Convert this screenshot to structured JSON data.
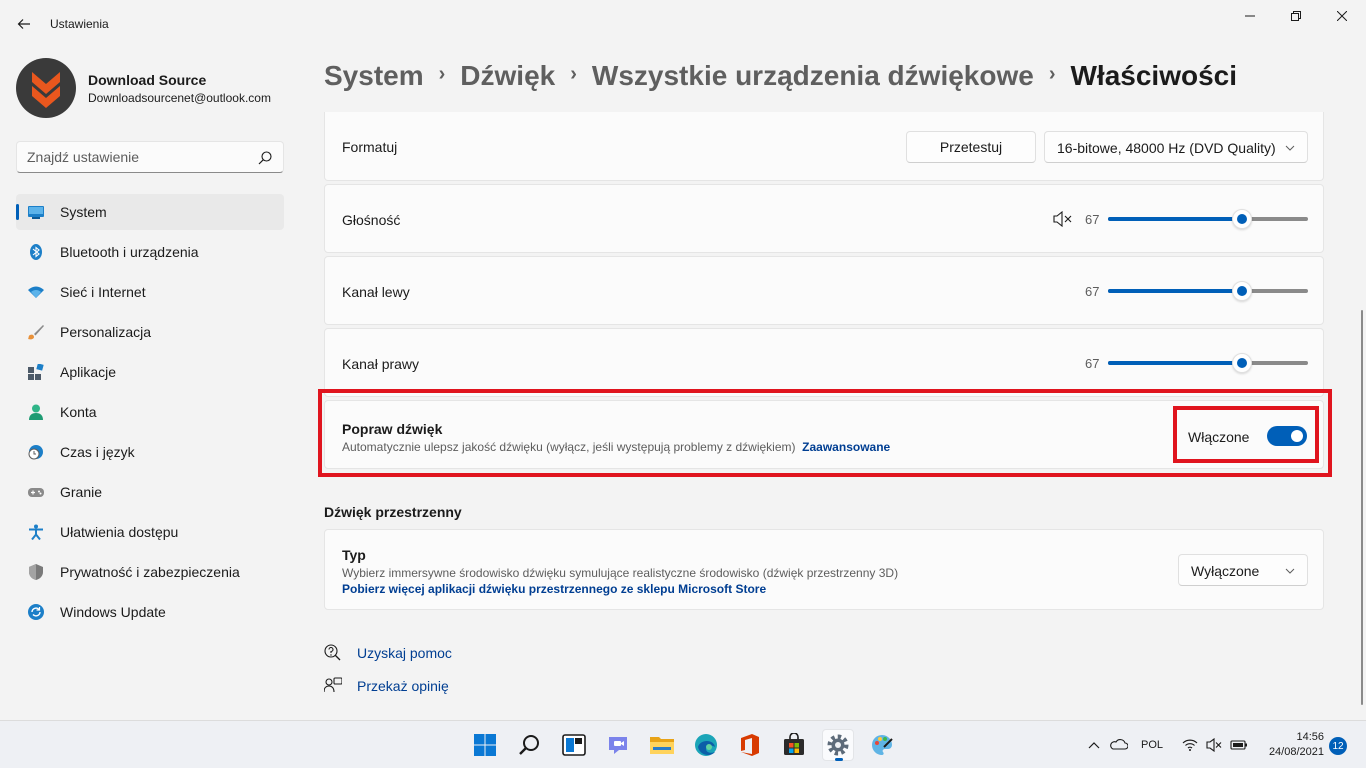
{
  "app": {
    "title": "Ustawienia"
  },
  "profile": {
    "name": "Download Source",
    "email": "Downloadsourcenet@outlook.com"
  },
  "search": {
    "placeholder": "Znajdź ustawienie"
  },
  "sidebar": {
    "items": [
      {
        "label": "System",
        "icon": "system-icon",
        "active": true
      },
      {
        "label": "Bluetooth i urządzenia",
        "icon": "bluetooth-icon"
      },
      {
        "label": "Sieć i Internet",
        "icon": "wifi-icon"
      },
      {
        "label": "Personalizacja",
        "icon": "brush-icon"
      },
      {
        "label": "Aplikacje",
        "icon": "apps-icon"
      },
      {
        "label": "Konta",
        "icon": "person-icon"
      },
      {
        "label": "Czas i język",
        "icon": "globe-clock-icon"
      },
      {
        "label": "Granie",
        "icon": "gamepad-icon"
      },
      {
        "label": "Ułatwienia dostępu",
        "icon": "accessibility-icon"
      },
      {
        "label": "Prywatność i zabezpieczenia",
        "icon": "shield-icon"
      },
      {
        "label": "Windows Update",
        "icon": "update-icon"
      }
    ]
  },
  "breadcrumb": {
    "items": [
      "System",
      "Dźwięk",
      "Wszystkie urządzenia dźwiękowe"
    ],
    "current": "Właściwości",
    "separator": "›"
  },
  "format": {
    "label": "Formatuj",
    "test_button": "Przetestuj",
    "selected": "16-bitowe, 48000 Hz (DVD Quality)"
  },
  "volume": {
    "label": "Głośność",
    "value": "67",
    "fraction": 0.67
  },
  "left_channel": {
    "label": "Kanał lewy",
    "value": "67",
    "fraction": 0.67
  },
  "right_channel": {
    "label": "Kanał prawy",
    "value": "67",
    "fraction": 0.67
  },
  "enhance": {
    "title": "Popraw dźwięk",
    "description": "Automatycznie ulepsz jakość dźwięku (wyłącz, jeśli występują problemy z dźwiękiem)",
    "link": "Zaawansowane",
    "state_label": "Włączone",
    "on": true
  },
  "spatial": {
    "section_title": "Dźwięk przestrzenny",
    "title": "Typ",
    "description": "Wybierz immersywne środowisko dźwięku symulujące realistyczne środowisko (dźwięk przestrzenny 3D)",
    "link": "Pobierz więcej aplikacji dźwięku przestrzennego ze sklepu Microsoft Store",
    "selected": "Wyłączone"
  },
  "help": {
    "get_help": "Uzyskaj pomoc",
    "feedback": "Przekaż opinię"
  },
  "taskbar": {
    "language": "POL",
    "time": "14:56",
    "date": "24/08/2021",
    "notifications": "12"
  },
  "colors": {
    "accent": "#005fb8",
    "highlight": "#e0141e",
    "background": "#f3f3f3"
  }
}
